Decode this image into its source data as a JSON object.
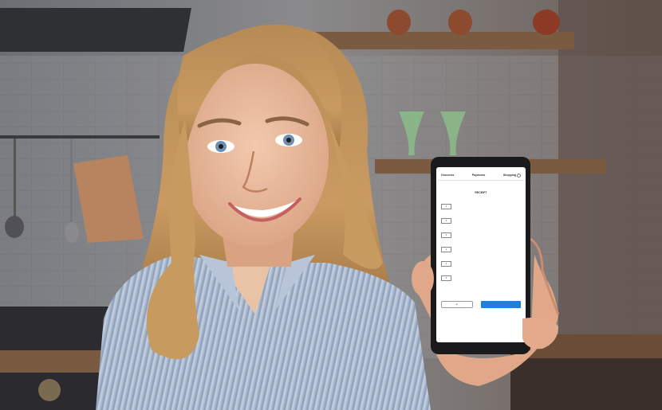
{
  "phone_screen": {
    "tabs": [
      {
        "label": "Groceries"
      },
      {
        "label": "Payments"
      },
      {
        "label": "Shopping"
      }
    ],
    "receipt_title": "RECEIPT",
    "items": [
      {
        "qty": "1",
        "name": "",
        "price": ""
      },
      {
        "qty": "1",
        "name": "",
        "price": ""
      },
      {
        "qty": "1",
        "name": "",
        "price": ""
      },
      {
        "qty": "1",
        "name": "",
        "price": ""
      },
      {
        "qty": "1",
        "name": "",
        "price": ""
      },
      {
        "qty": "1",
        "name": "",
        "price": ""
      }
    ],
    "totals": {
      "subtotal_label": "",
      "subtotal_value": "",
      "total_label": "",
      "total_value": ""
    },
    "share_button_label": "",
    "checkout_button_label": "",
    "accent_color": "#1f7fe0"
  }
}
